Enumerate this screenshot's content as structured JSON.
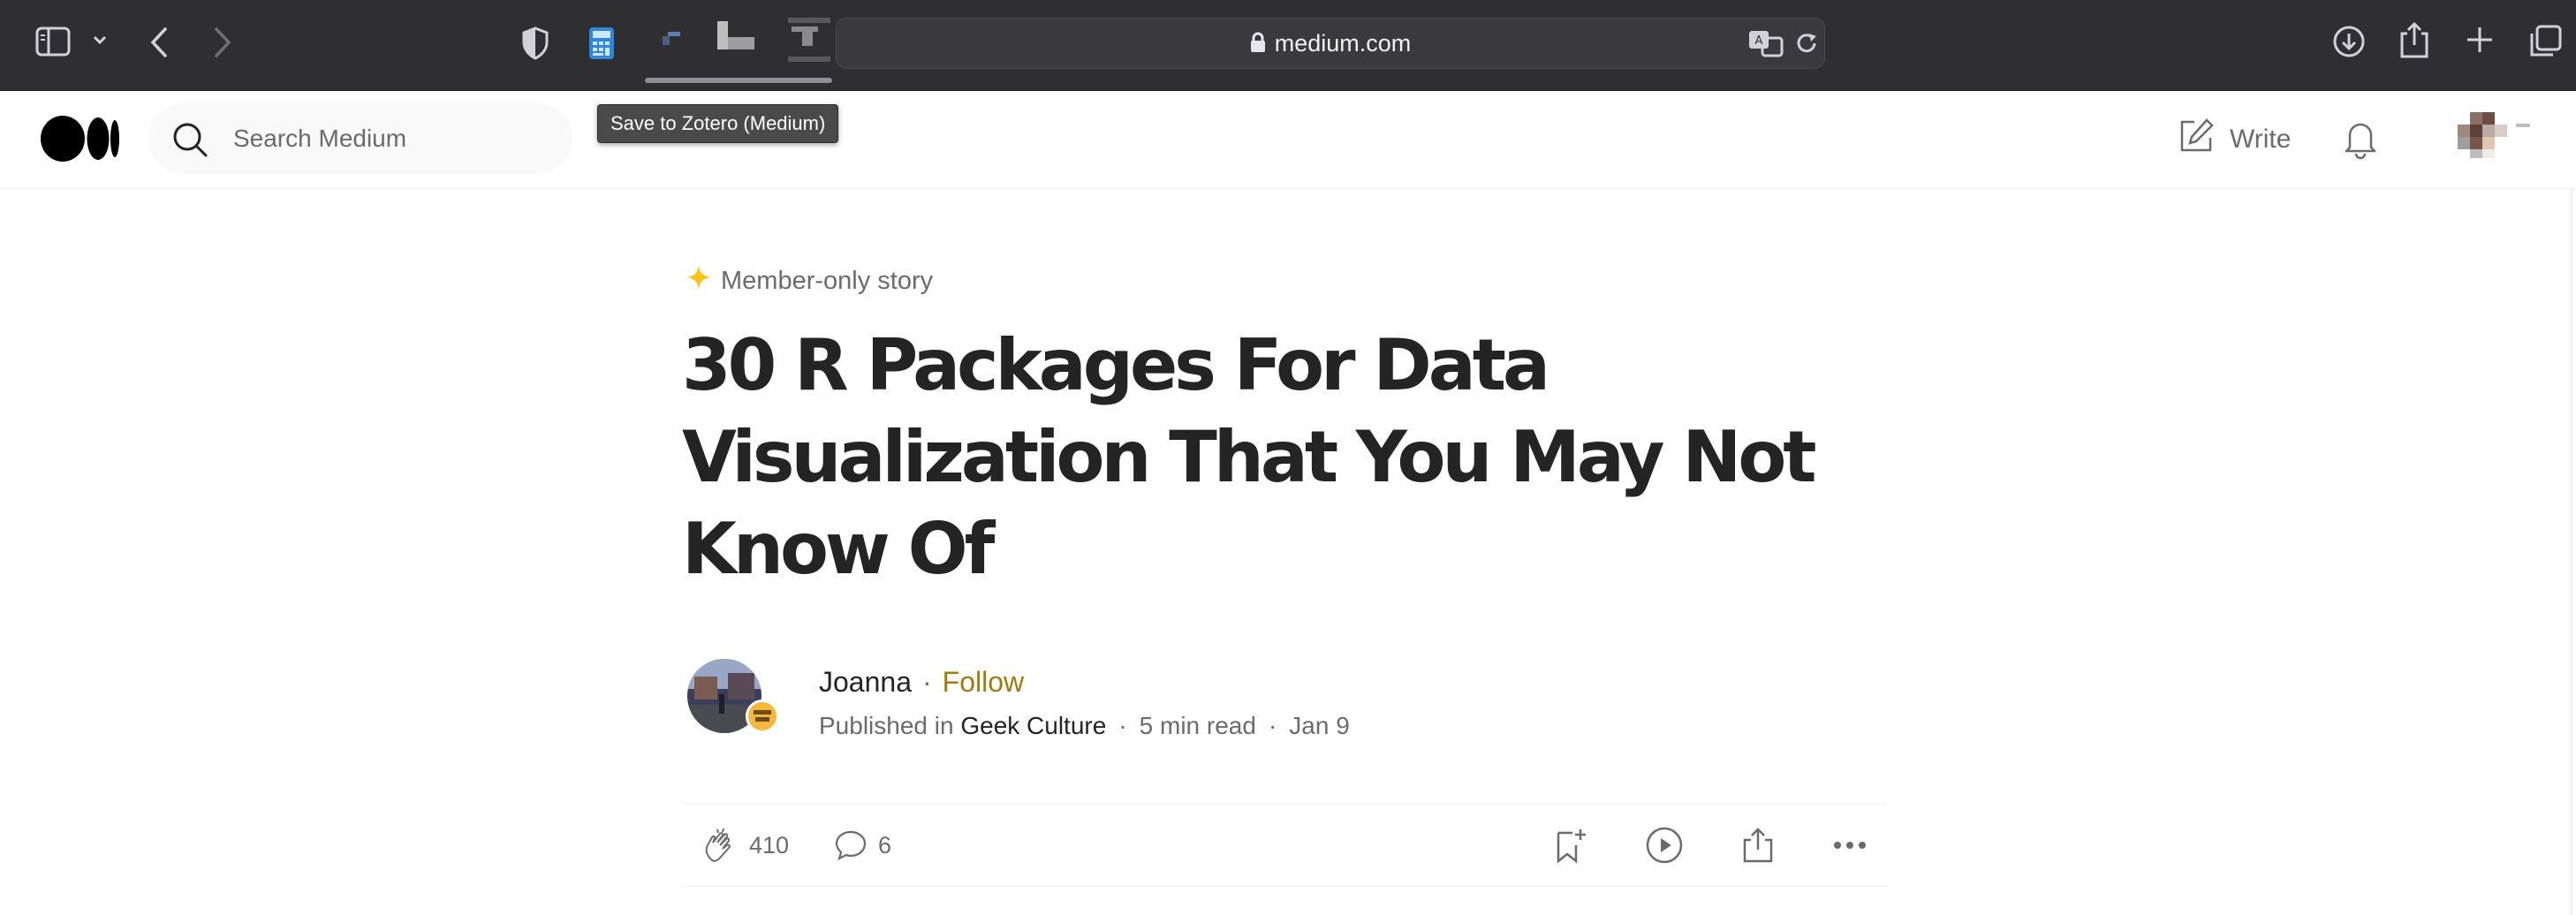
{
  "browser": {
    "url": "medium.com",
    "tooltip": "Save to Zotero (Medium)",
    "icons": [
      "sidebar-icon",
      "chevron-down-icon",
      "back-icon",
      "forward-icon",
      "shield-icon",
      "calculator-icon",
      "extension-icon",
      "extension-icon",
      "extension-icon",
      "translate-icon",
      "reload-icon",
      "download-icon",
      "share-icon",
      "plus-icon",
      "tabs-icon"
    ]
  },
  "header": {
    "search_placeholder": "Search Medium",
    "write_label": "Write"
  },
  "article": {
    "member_label": "Member-only story",
    "title": "30 R Packages For Data Visualization That You May Not Know Of",
    "author": "Joanna",
    "dot": "·",
    "follow_label": "Follow",
    "published_prefix": "Published in",
    "publication": "Geek Culture",
    "read_time": "5 min read",
    "date": "Jan 9",
    "claps": "410",
    "responses": "6",
    "publication_badge": "Geek Culture"
  },
  "colors": {
    "toolbar_bg": "#2f2f31",
    "follow": "#a07a0c",
    "member_star": "#ffc017",
    "text_primary": "#242424",
    "text_secondary": "#6b6b6b"
  }
}
